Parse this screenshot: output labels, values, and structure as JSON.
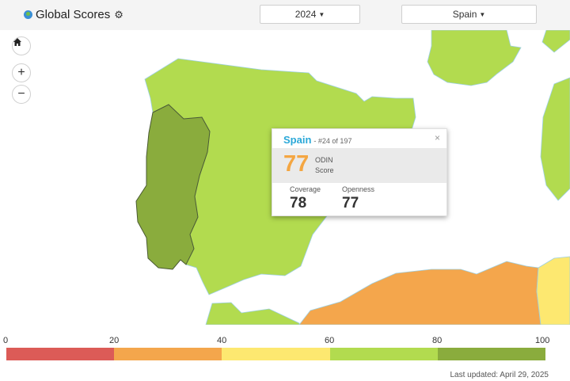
{
  "header": {
    "title": "Global Scores",
    "year_selected": "2024",
    "country_selected": "Spain"
  },
  "map_controls": {
    "home_icon": "home-icon",
    "zoom_in": "+",
    "zoom_out": "−"
  },
  "colors": {
    "score_0_20": "#dc5b57",
    "score_20_40": "#f4a64c",
    "score_40_60": "#fde870",
    "score_60_80": "#b2db4f",
    "score_80_100": "#8aac3d",
    "accent_blue": "#2aa8d8",
    "score_orange": "#f4a642"
  },
  "tooltip": {
    "country": "Spain",
    "rank": "- #24 of 197",
    "score": "77",
    "score_label": "ODIN Score",
    "close_symbol": "×",
    "metrics": [
      {
        "label": "Coverage",
        "value": "78"
      },
      {
        "label": "Openness",
        "value": "77"
      }
    ]
  },
  "legend": {
    "ticks": [
      "0",
      "20",
      "40",
      "60",
      "80",
      "100"
    ],
    "ranges": [
      "0-20",
      "20-40",
      "40-60",
      "60-80",
      "80-100"
    ]
  },
  "footer": {
    "last_updated": "Last updated: April 29, 2025"
  }
}
